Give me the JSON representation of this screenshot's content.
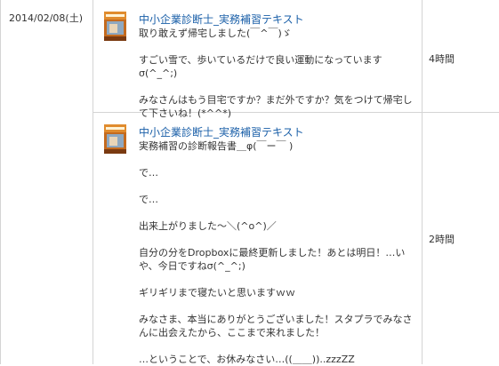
{
  "date": "2014/02/08(土)",
  "entries": [
    {
      "book_title": "中小企業診断士_実務補習テキスト",
      "book_thumb_icon": "book-cover-thumbnail",
      "lines": [
        "取り敢えず帰宅しました(￣^￣)ゞ",
        "すごい雪で、歩いているだけで良い運動になっていますσ(^_^;)",
        "みなさんはもう目宅ですか？まだ外ですか？気をつけて帰宅して下さいね！(*^^*)"
      ],
      "time": "4時間"
    },
    {
      "book_title": "中小企業診断士_実務補習テキスト",
      "book_thumb_icon": "book-cover-thumbnail",
      "lines": [
        "実務補習の診断報告書＿φ(￣ー￣ )",
        "で…",
        "で…",
        "出来上がりました〜＼(^o^)／",
        "自分の分をDropboxに最終更新しました！あとは明日！…いや、今日ですねσ(^_^;)",
        "ギリギリまで寝たいと思いますｗｗ",
        "みなさま、本当にありがとうございました！スタプラでみなさんに出会えたから、ここまで来れました！",
        "…ということで、お休みなさい…((＿＿))..zzzZZ"
      ],
      "time": "2時間"
    }
  ]
}
